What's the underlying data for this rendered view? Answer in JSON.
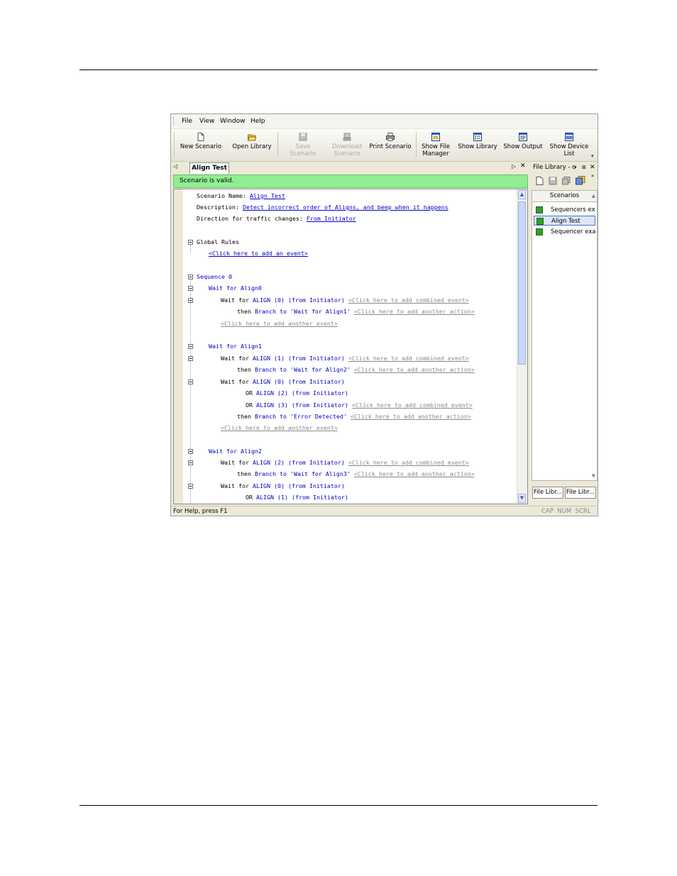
{
  "menu": [
    "File",
    "View",
    "Window",
    "Help"
  ],
  "toolbar": [
    {
      "label": "New Scenario",
      "icon": "new-document-icon",
      "enabled": true
    },
    {
      "label": "Open Library",
      "icon": "open-folder-icon",
      "enabled": true
    },
    {
      "label": "Save Scenario",
      "icon": "save-icon",
      "enabled": false
    },
    {
      "label": "Download Scenario",
      "icon": "download-icon",
      "enabled": false
    },
    {
      "label": "Print Scenario",
      "icon": "printer-icon",
      "enabled": true
    },
    {
      "label": "Show File Manager",
      "icon": "file-manager-icon",
      "enabled": true
    },
    {
      "label": "Show Library",
      "icon": "library-icon",
      "enabled": true
    },
    {
      "label": "Show Output",
      "icon": "output-icon",
      "enabled": true
    },
    {
      "label": "Show Device List",
      "icon": "device-list-icon",
      "enabled": true
    }
  ],
  "tab": {
    "title": "Align Test",
    "scroll_left": "◁",
    "scroll_right": "▷",
    "close": "✕"
  },
  "validation": "Scenario is valid.",
  "scenario": {
    "name_label": "Scenario Name:",
    "name": "Align Test",
    "desc_label": "Description:",
    "description": "Detect incorrect order of Aligns, and beep when it happens",
    "direction_label": "Direction for traffic changes:",
    "direction": "From Initiator",
    "global_rules": "Global Rules",
    "add_event": "<Click here to add an event>",
    "sequence": "Sequence 0",
    "states": [
      {
        "name": "Wait for Align0"
      },
      {
        "name": "Wait for Align1"
      },
      {
        "name": "Wait for Align2"
      }
    ],
    "wait_for": "Wait for",
    "or": "OR",
    "then": "then",
    "branch": "Branch",
    "to": "to",
    "from": "(from Initiator)",
    "align": "ALIGN",
    "align_idx": [
      "(0)",
      "(1)",
      "(2)",
      "(3)"
    ],
    "targets": [
      "'Wait for Align1'",
      "'Wait for Align2'",
      "'Error Detected'",
      "'Wait for Align3'"
    ],
    "add_combined": "<Click here to add combined event>",
    "add_action": "<Click here to add another action>",
    "add_another_event": "<Click here to add another event>"
  },
  "panel": {
    "title": "File Library - c",
    "scenarios_header": "Scenarios",
    "items": [
      "Sequencers ex...",
      "Align Test",
      "Sequencer exa..."
    ],
    "selected": 1,
    "tabs": [
      "File Libr...",
      "File Libr..."
    ]
  },
  "statusbar": {
    "help": "For Help, press F1",
    "indicators": "CAP  NUM  SCRL"
  },
  "colors": {
    "valid_bg": "#90ee90",
    "keyword": "#0000c8",
    "placeholder": "#8a8a8a"
  }
}
